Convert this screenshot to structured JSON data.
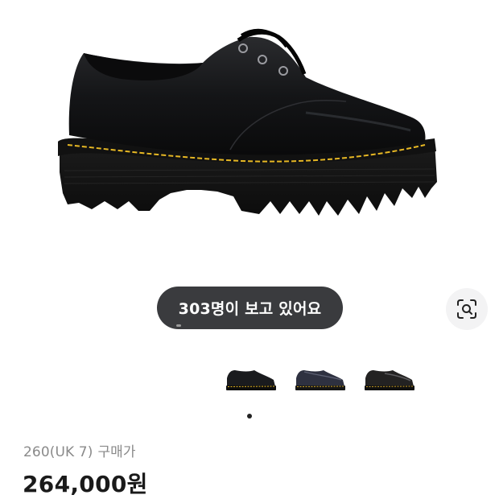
{
  "product": {
    "image_icon": "black-leather-derby-shoe-platform-sole",
    "viewers_text": "303명이 보고 있어요",
    "size": "260(UK 7)",
    "price_type": "구매가",
    "price": "264,000원"
  },
  "gallery": {
    "thumbnails": [
      {
        "icon": "black-shoe-thumbnail"
      },
      {
        "icon": "navy-shoe-thumbnail"
      },
      {
        "icon": "dark-shoe-thumbnail"
      }
    ],
    "active_index": 0,
    "dot_count": 1
  },
  "actions": {
    "lens_icon": "image-search-icon"
  },
  "colors": {
    "pill_bg": "#3a3b3e",
    "pill_text": "#ffffff",
    "price_text": "#1a1a1a",
    "muted_text": "#8a8a8a",
    "stitch": "#e7b824",
    "lens_bg": "#f3f3f4"
  }
}
